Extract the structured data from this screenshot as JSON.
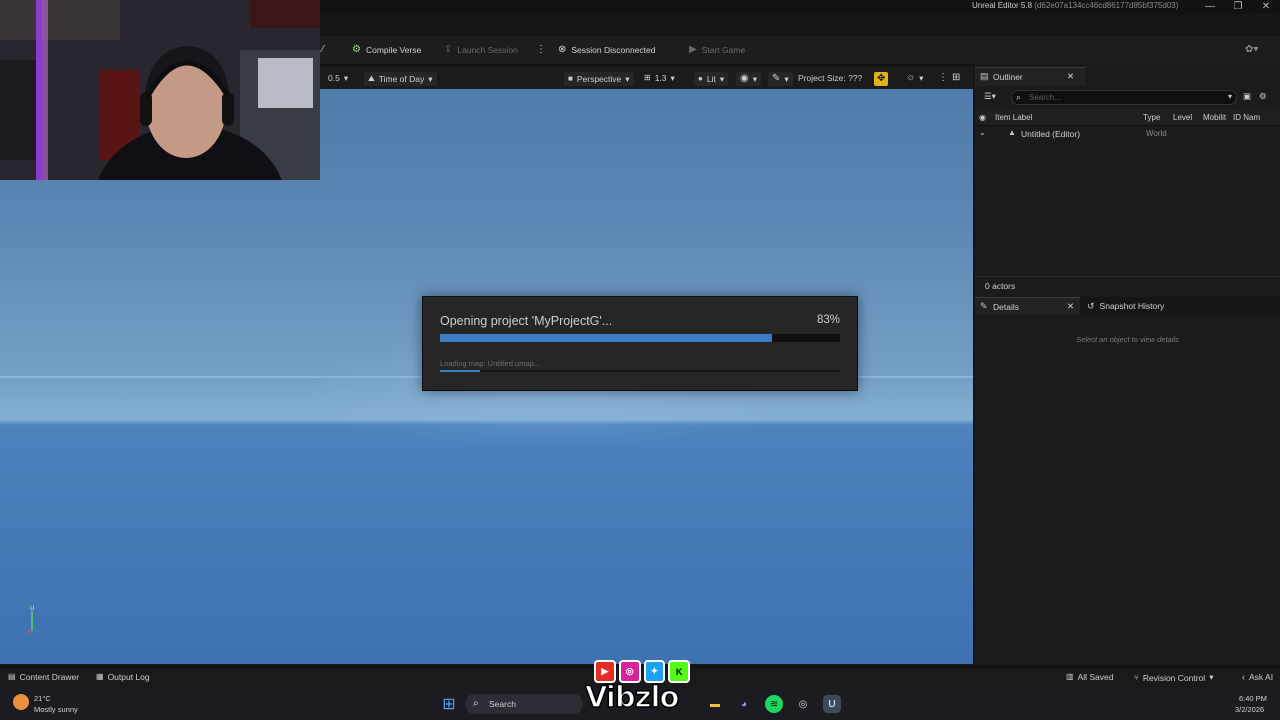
{
  "window": {
    "title": "Unreal Editor 5.8",
    "hash": "(d62e07a134cc46cd86177d85bf375d03)",
    "controls": [
      "—",
      "❐",
      "✕"
    ]
  },
  "toolbar": {
    "compile_verse": "Compile Verse",
    "launch_session": "Launch Session",
    "session_status": "Session Disconnected",
    "start_game": "Start Game"
  },
  "viewport_toolbar": {
    "speed": "0.5",
    "time_of_day": "Time of Day",
    "perspective": "Perspective",
    "fov": "1.3",
    "lit": "Lit",
    "project_size": "Project Size: ???"
  },
  "loading": {
    "title": "Opening project 'MyProjectG'...",
    "percent_label": "83%",
    "progress": 0.83,
    "status": "Loading map: Untitled.umap...",
    "sub_progress": 0.1
  },
  "outliner": {
    "tab": "Outliner",
    "search_placeholder": "Search...",
    "columns": [
      "Item Label",
      "Type",
      "Level",
      "Mobilit",
      "ID Nam"
    ],
    "rows": [
      {
        "label": "Untitled (Editor)",
        "type": "World"
      }
    ],
    "footer": "0 actors"
  },
  "details": {
    "tab": "Details",
    "snapshot_tab": "Snapshot History",
    "empty": "Select an object to view details"
  },
  "statusbar": {
    "content_drawer": "Content Drawer",
    "output_log": "Output Log",
    "all_saved": "All Saved",
    "revision_control": "Revision Control",
    "ask_ai": "Ask AI"
  },
  "taskbar": {
    "weather_temp": "21°C",
    "weather_desc": "Mostly sunny",
    "search": "Search",
    "time": "6:40 PM",
    "date": "3/2/2026"
  },
  "overlay": {
    "brand": "Vibzlo",
    "socials": [
      "youtube-icon",
      "instagram-icon",
      "twitter-icon",
      "kick-icon"
    ]
  }
}
